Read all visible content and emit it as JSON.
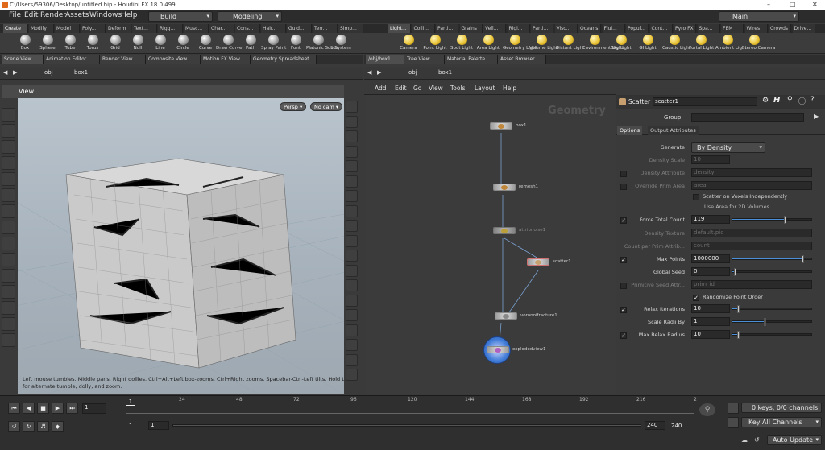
{
  "window": {
    "title": "C:/Users/59306/Desktop/untitled.hip - Houdini FX 18.0.499"
  },
  "menu": {
    "items": [
      "File",
      "Edit",
      "Render",
      "Assets",
      "Windows",
      "Help"
    ],
    "build_label": "Build",
    "desktop": "Modeling",
    "main_label": "Main"
  },
  "shelf_tabs_left": [
    "Create",
    "Modify",
    "Model",
    "Poly...",
    "Deform",
    "Text...",
    "Rigg...",
    "Musc...",
    "Char...",
    "Cons...",
    "Hair...",
    "Guid...",
    "Terr...",
    "Simp..."
  ],
  "shelf_tabs_right": [
    "Light...",
    "Colli...",
    "Parti...",
    "Grains",
    "Vell...",
    "Rigi...",
    "Parti...",
    "Visc...",
    "Oceans",
    "Flui...",
    "Popul...",
    "Cont...",
    "Pyro FX",
    "Spa...",
    "FEM",
    "Wires",
    "Crowds",
    "Drive..."
  ],
  "shelf_tools_left": [
    "Box",
    "Sphere",
    "Tube",
    "Torus",
    "Grid",
    "Null",
    "Line",
    "Circle",
    "Curve",
    "Draw Curve",
    "Path",
    "Spray Paint",
    "Font",
    "Platonic Solids",
    "L-System"
  ],
  "shelf_tools_right": [
    "Camera",
    "Point Light",
    "Spot Light",
    "Area Light",
    "Geometry Light",
    "Volume Light",
    "Distant Light",
    "Environment Light",
    "Sky Light",
    "GI Light",
    "Caustic Light",
    "Portal Light",
    "Ambient Light",
    "Stereo Camera"
  ],
  "left_pane_tabs": [
    "Scene View",
    "Animation Editor",
    "Render View",
    "Composite View",
    "Motion FX View",
    "Geometry Spreadsheet"
  ],
  "right_pane_tabs": [
    "/obj/box1",
    "Tree View",
    "Material Palette",
    "Asset Browser"
  ],
  "left_path": {
    "obj": "obj",
    "node": "box1"
  },
  "right_path": {
    "obj": "obj",
    "node": "box1"
  },
  "viewer": {
    "title": "View",
    "persp": "Persp",
    "cam": "No cam",
    "hint": "Left mouse tumbles. Middle pans. Right dollies. Ctrl+Alt+Left box-zooms. Ctrl+Right zooms. Spacebar-Ctrl-Left tilts. Hold L for alternate tumble, dolly, and zoom."
  },
  "network": {
    "menu": [
      "Add",
      "Edit",
      "Go",
      "View",
      "Tools",
      "Layout",
      "Help"
    ],
    "watermark": "Geometry",
    "nodes": [
      "box1",
      "remesh1",
      "attribnoise1",
      "scatter1",
      "voronoifracture1",
      "explodedview1"
    ]
  },
  "params": {
    "node_type": "Scatter",
    "node_name": "scatter1",
    "group_label": "Group",
    "tabs": [
      "Options",
      "Output Attributes"
    ],
    "rows": [
      {
        "label": "Generate",
        "value": "By Density"
      },
      {
        "label": "Density Scale",
        "value": "10"
      },
      {
        "label": "Density Attribute",
        "value": "density"
      },
      {
        "label": "Override Prim Area",
        "value": "area"
      },
      {
        "label": "Scatter on Voxels Independently",
        "value": ""
      },
      {
        "label": "Use Area for 2D Volumes",
        "value": ""
      },
      {
        "label": "Force Total Count",
        "value": "119"
      },
      {
        "label": "Density Texture",
        "value": "default.pic"
      },
      {
        "label": "Count per Prim Attrib...",
        "value": "count"
      },
      {
        "label": "Max Points",
        "value": "1000000"
      },
      {
        "label": "Global Seed",
        "value": "0"
      },
      {
        "label": "Primitive Seed Attr...",
        "value": "prim_id"
      },
      {
        "label": "Randomize Point Order",
        "value": ""
      },
      {
        "label": "Relax Iterations",
        "value": "10"
      },
      {
        "label": "Scale Radii By",
        "value": "1"
      },
      {
        "label": "Max Relax Radius",
        "value": "10"
      }
    ]
  },
  "timeline": {
    "frame": "1",
    "ticks": [
      "24",
      "48",
      "72",
      "96",
      "120",
      "144",
      "168",
      "192",
      "216",
      "2"
    ],
    "range_start": "1",
    "range_start2": "1",
    "range_end": "240",
    "range_end2": "240",
    "keys": "0 keys, 0/0 channels",
    "channels": "Key All Channels",
    "update": "Auto Update"
  },
  "colors": {
    "accent": "#4a8fd8",
    "node": "#c0863a",
    "selected_node": "#3e7ad6"
  }
}
